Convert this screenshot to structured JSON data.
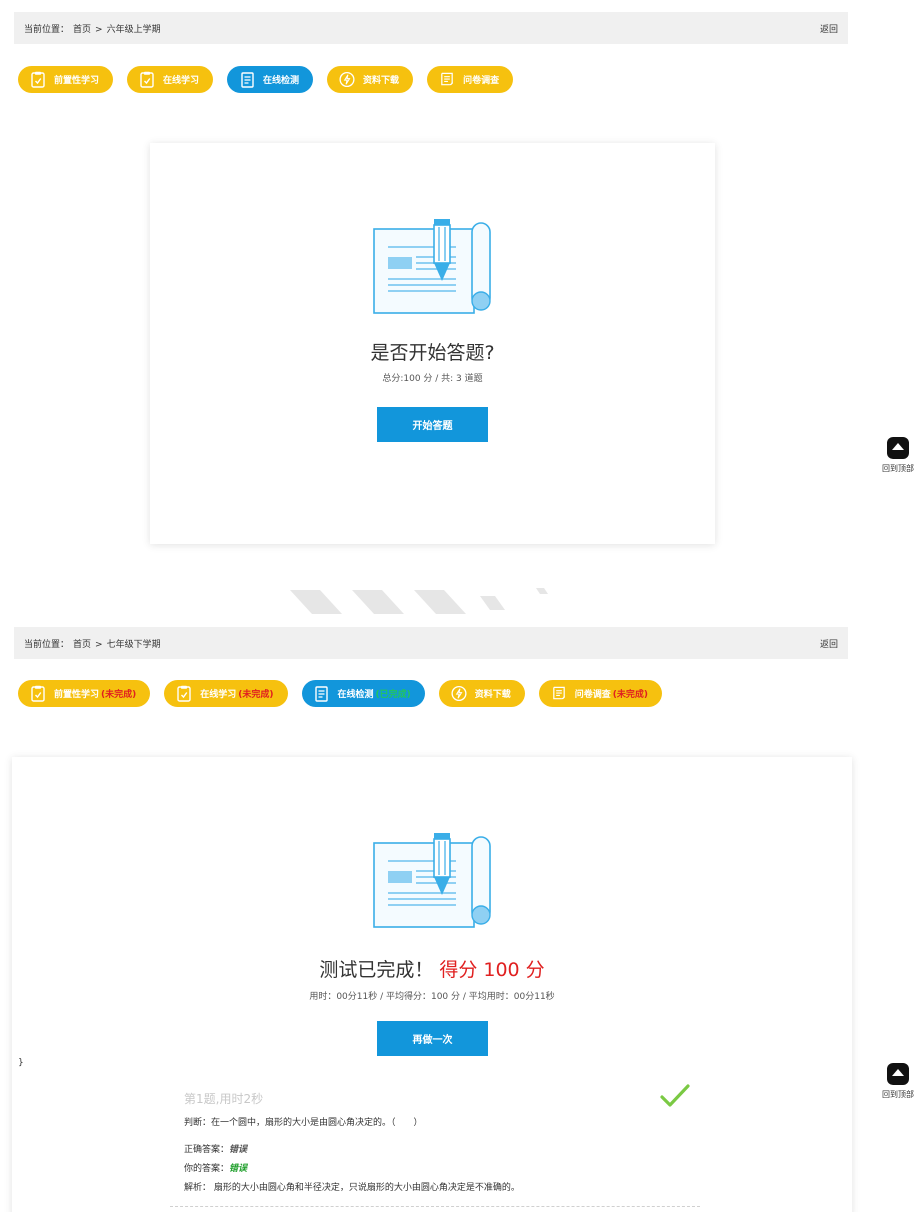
{
  "panel1": {
    "breadcrumb": {
      "prefix": "当前位置：",
      "home": "首页",
      "sep": ">",
      "current": "六年级上学期",
      "back": "返回"
    },
    "tabs": [
      {
        "label": "前置性学习",
        "icon": "clipboard-check-icon",
        "active": false
      },
      {
        "label": "在线学习",
        "icon": "clipboard-check-icon",
        "active": false
      },
      {
        "label": "在线检测",
        "icon": "document-lines-icon",
        "active": true
      },
      {
        "label": "资料下载",
        "icon": "lightning-circle-icon",
        "active": false
      },
      {
        "label": "问卷调查",
        "icon": "survey-scroll-icon",
        "active": false
      }
    ],
    "heading": "是否开始答题?",
    "meta": "总分:100 分 / 共: 3 道题",
    "button": "开始答题"
  },
  "panel2": {
    "breadcrumb": {
      "prefix": "当前位置：",
      "home": "首页",
      "sep": ">",
      "current": "七年级下学期",
      "back": "返回"
    },
    "tabs": [
      {
        "label": "前置性学习",
        "status": "(未完成)",
        "status_color": "red",
        "icon": "clipboard-check-icon",
        "active": false
      },
      {
        "label": "在线学习",
        "status": "(未完成)",
        "status_color": "red",
        "icon": "clipboard-check-icon",
        "active": false
      },
      {
        "label": "在线检测",
        "status": "(已完成)",
        "status_color": "green",
        "icon": "document-lines-icon",
        "active": true
      },
      {
        "label": "资料下载",
        "status": "",
        "status_color": "",
        "icon": "lightning-circle-icon",
        "active": false
      },
      {
        "label": "问卷调查",
        "status": "(未完成)",
        "status_color": "red",
        "icon": "survey-scroll-icon",
        "active": false
      }
    ],
    "heading": "测试已完成！",
    "score": "得分 100 分",
    "meta": "用时：00分11秒 / 平均得分：100 分 / 平均用时：00分11秒",
    "button": "再做一次",
    "stray_char": "}",
    "question": {
      "title": "第1题,用时2秒",
      "text": "判断：在一个圆中，扇形的大小是由圆心角决定的。（　　）",
      "correct_label": "正确答案：",
      "correct_value": "错误",
      "yours_label": "你的答案：",
      "yours_value": "错误",
      "analysis_label": "解析：",
      "analysis_text": "扇形的大小由圆心角和半径决定，只说扇形的大小由圆心角决定是不准确的。"
    }
  },
  "back_to_top": "回到顶部",
  "colors": {
    "tab_yellow": "#f6c10f",
    "tab_blue": "#1296db",
    "score_red": "#e02020",
    "done_green": "#22c55e",
    "check_green": "#7ac943"
  }
}
